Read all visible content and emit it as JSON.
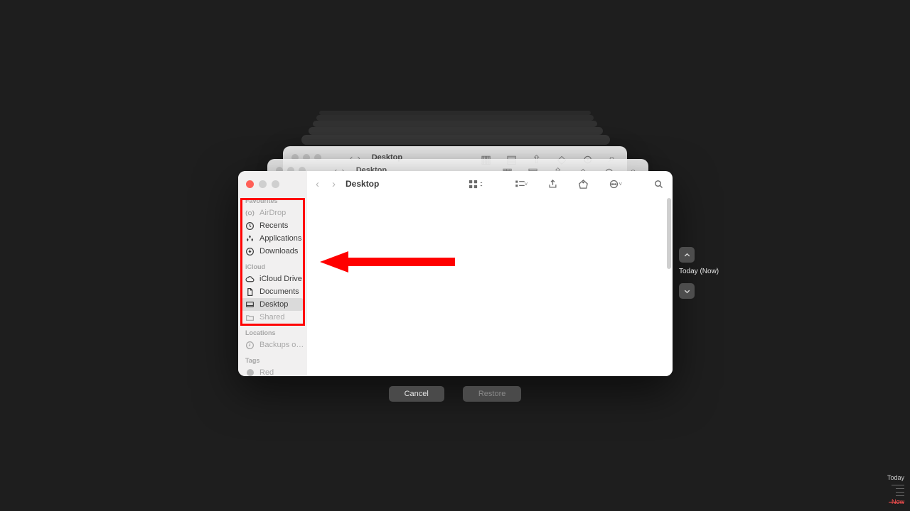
{
  "window": {
    "title": "Desktop"
  },
  "sidebar": {
    "sections": {
      "favourites": "Favourites",
      "icloud": "iCloud",
      "locations": "Locations",
      "tags": "Tags"
    },
    "items": {
      "airdrop": "AirDrop",
      "recents": "Recents",
      "applications": "Applications",
      "downloads": "Downloads",
      "icloud_drive": "iCloud Drive",
      "documents": "Documents",
      "desktop": "Desktop",
      "shared": "Shared",
      "backups": "Backups o…",
      "tag_red": "Red"
    }
  },
  "buttons": {
    "cancel": "Cancel",
    "restore": "Restore"
  },
  "timemachine": {
    "current": "Today (Now)",
    "timeline_top": "Today",
    "timeline_now": "Now"
  },
  "background_window_titles": {
    "w1": "Desktop",
    "w2": "Desktop"
  }
}
